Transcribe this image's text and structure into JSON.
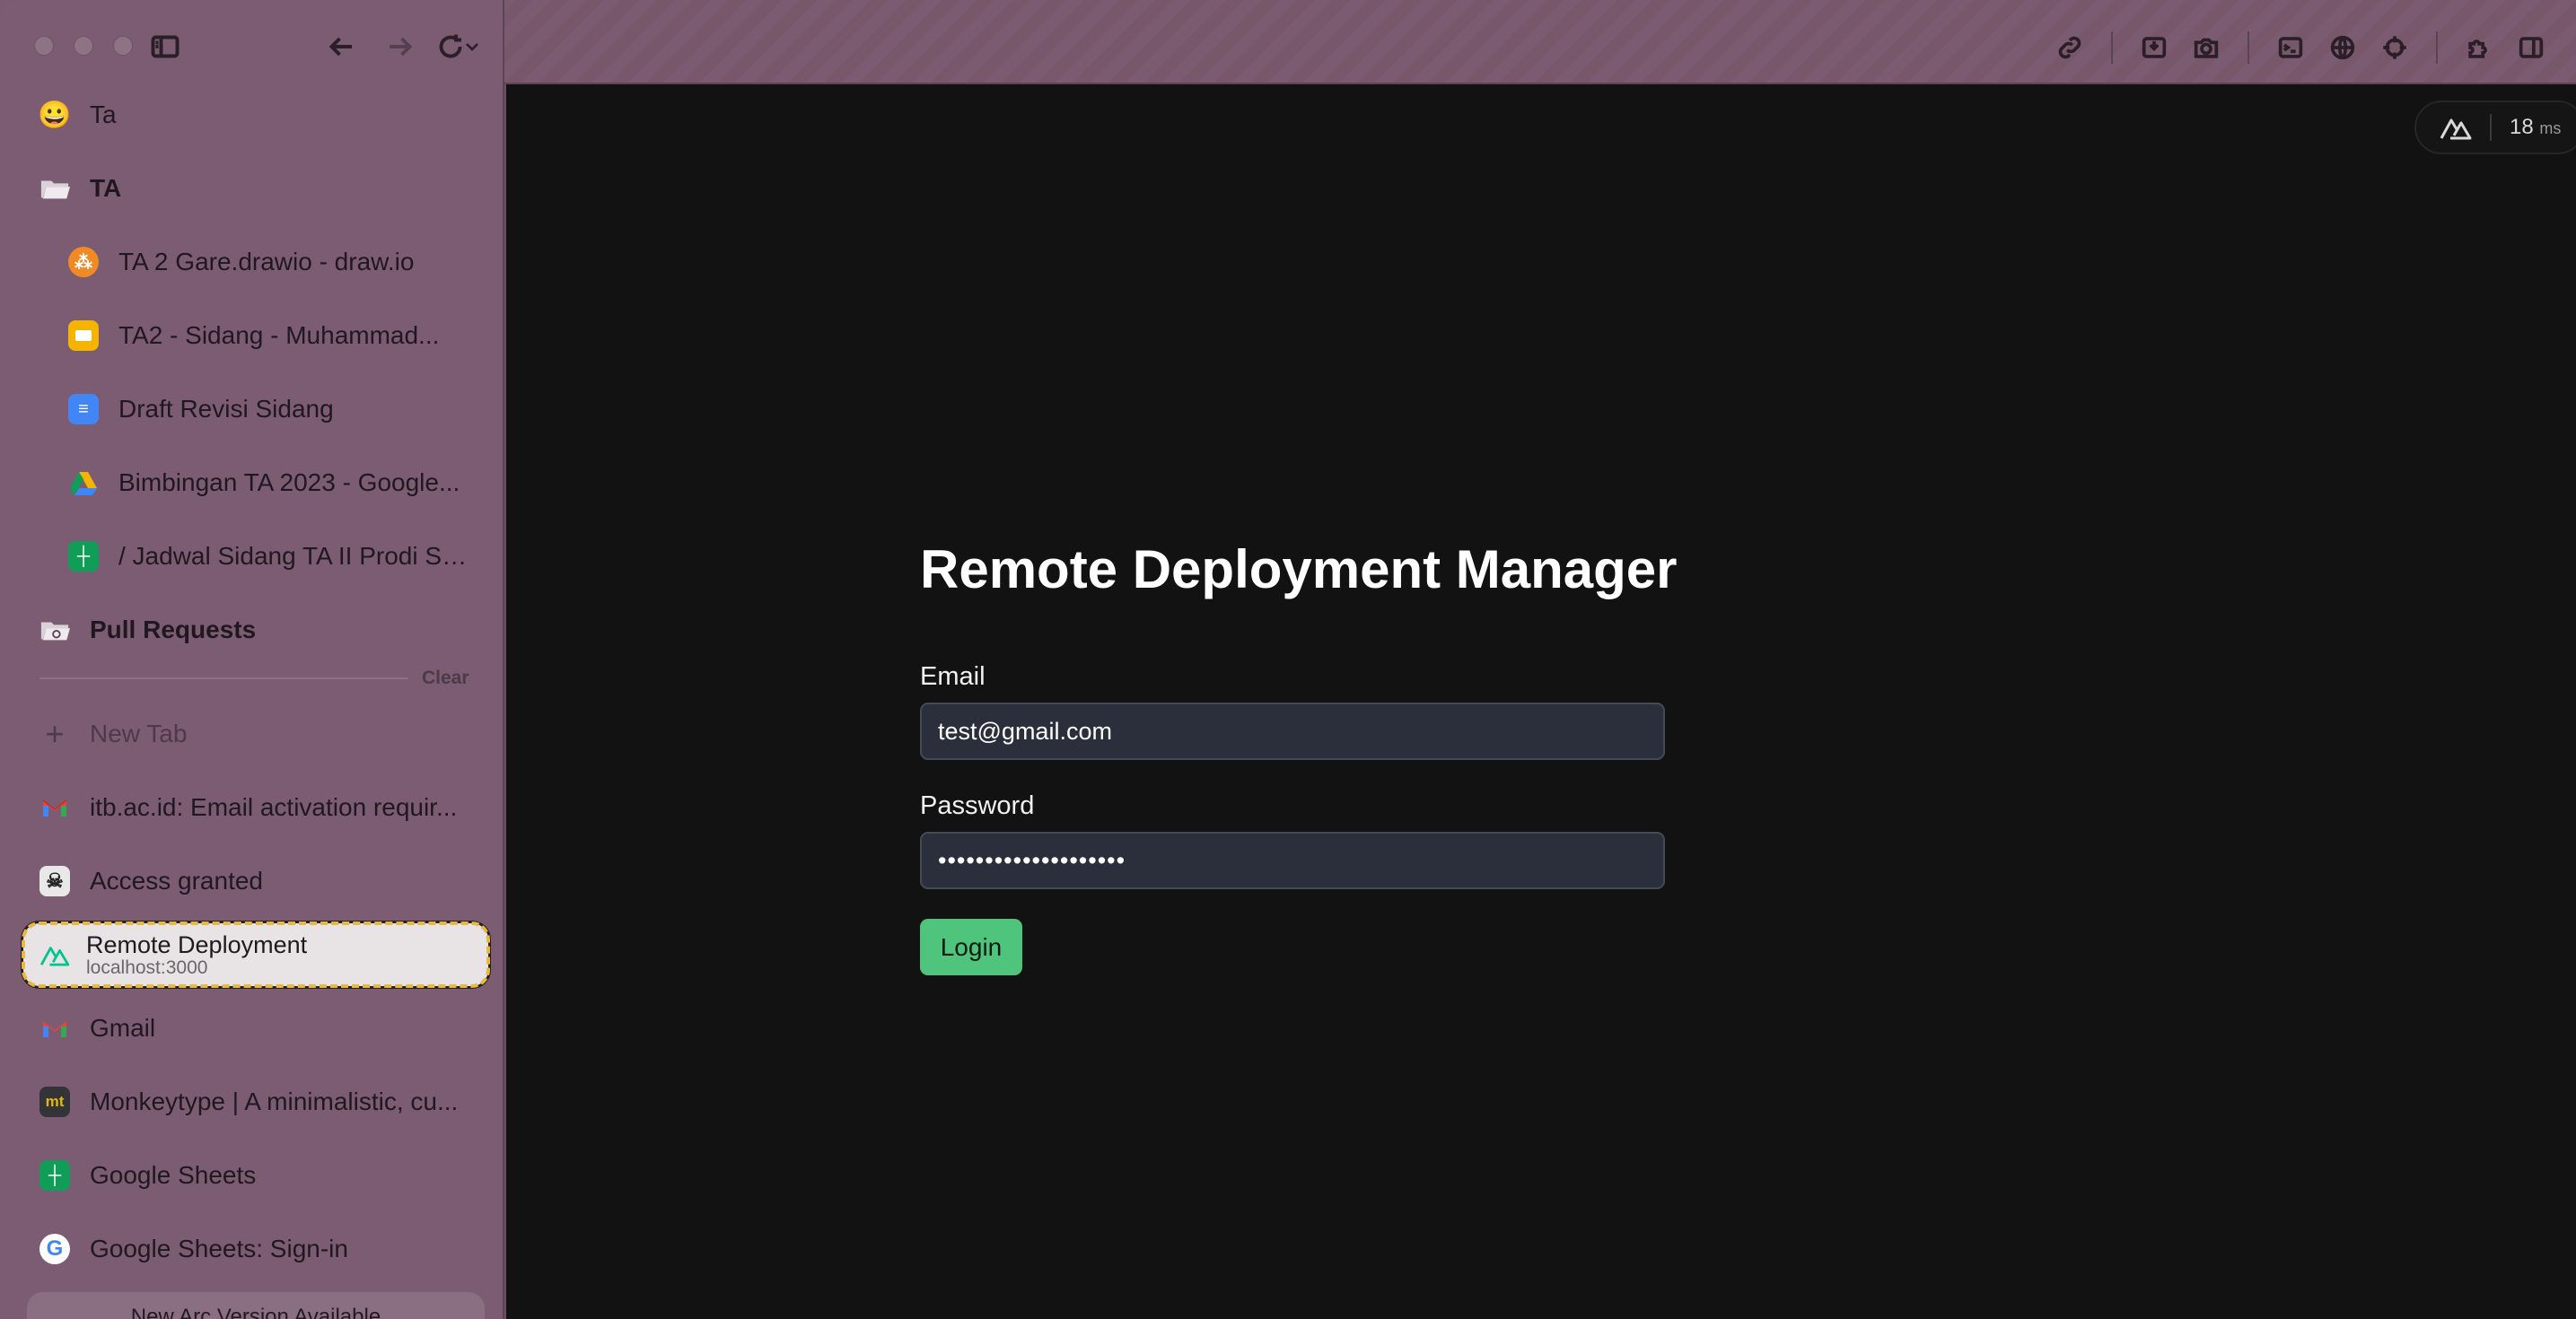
{
  "toolbar": {
    "icons": [
      "link-icon",
      "capture-icon",
      "camera-icon",
      "terminal-icon",
      "globe-icon",
      "crosshair-icon",
      "extensions-icon",
      "split-view-icon"
    ]
  },
  "sidebar": {
    "pinned": [
      {
        "label": "Ta",
        "icon": "emoji-icon"
      }
    ],
    "folders": [
      {
        "label": "TA",
        "items": [
          {
            "label": "TA 2 Gare.drawio - draw.io",
            "icon": "drawio-icon",
            "color": "#f08a24"
          },
          {
            "label": "TA2 - Sidang - Muhammad...",
            "icon": "slides-icon",
            "color": "#f4b400"
          },
          {
            "label": "Draft Revisi Sidang",
            "icon": "docs-icon",
            "color": "#4285f4"
          },
          {
            "label": "Bimbingan TA 2023 - Google...",
            "icon": "drive-icon",
            "color": "#34a853"
          },
          {
            "label": "/ Jadwal Sidang TA II Prodi S1...",
            "icon": "sheets-icon",
            "color": "#0f9d58"
          }
        ]
      },
      {
        "label": "Pull Requests",
        "items": []
      }
    ],
    "clear_label": "Clear",
    "new_tab_label": "New Tab",
    "tabs": [
      {
        "label": "itb.ac.id: Email activation requir...",
        "icon": "gmail-icon"
      },
      {
        "label": "Access granted",
        "icon": "access-icon"
      },
      {
        "label": "Remote Deployment",
        "subtitle": "localhost:3000",
        "icon": "nuxt-icon",
        "active": true
      },
      {
        "label": "Gmail",
        "icon": "gmail-icon"
      },
      {
        "label": "Monkeytype | A minimalistic, cu...",
        "icon": "monkeytype-icon"
      },
      {
        "label": "Google Sheets",
        "icon": "sheets-icon"
      },
      {
        "label": "Google Sheets: Sign-in",
        "icon": "google-icon"
      }
    ],
    "update_banner": "New Arc Version Available"
  },
  "perf_badge": {
    "value": "18",
    "unit": "ms"
  },
  "login": {
    "title": "Remote Deployment Manager",
    "email_label": "Email",
    "email_value": "test@gmail.com",
    "password_label": "Password",
    "password_value": "••••••••••••••••••••",
    "submit_label": "Login"
  },
  "colors": {
    "accent": "#4fc47c",
    "sidebar_bg": "#7b5c72",
    "content_bg": "#121212",
    "input_bg": "#2a2f3b",
    "active_outline": "#e8b93a"
  }
}
